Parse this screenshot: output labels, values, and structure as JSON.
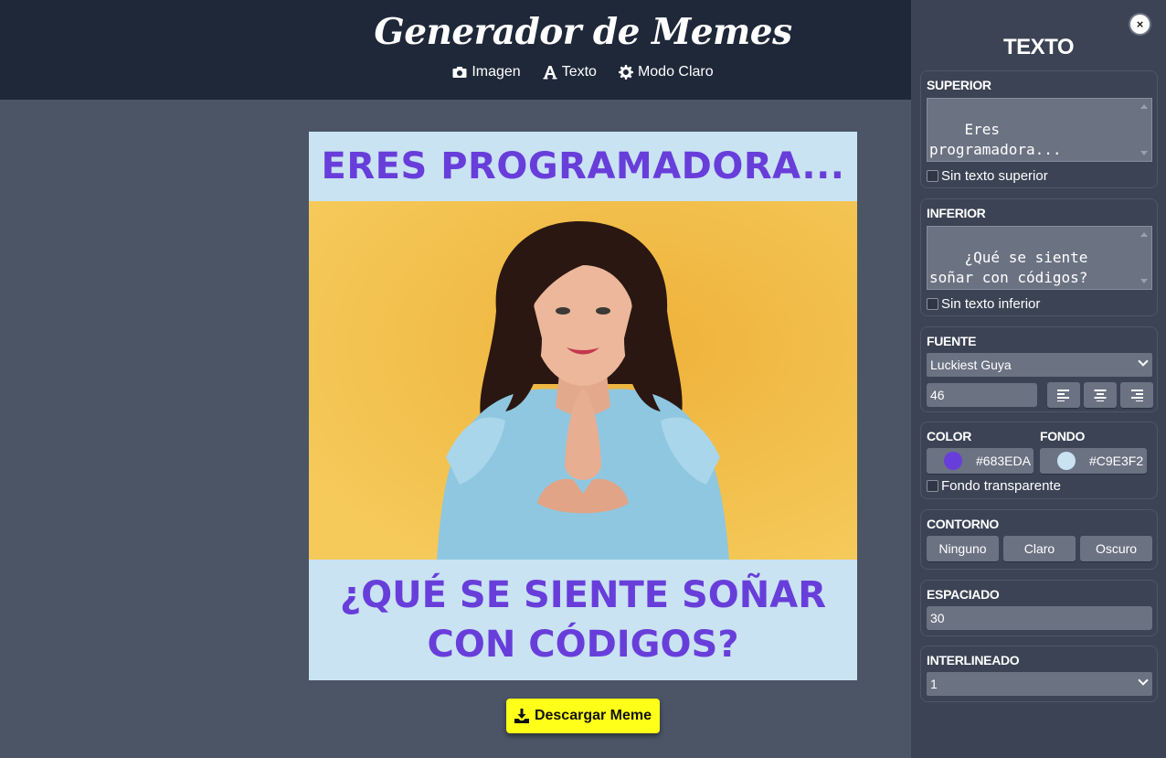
{
  "header": {
    "title": "Generador de Memes",
    "nav": [
      {
        "label": "Imagen",
        "icon": "camera-icon"
      },
      {
        "label": "Texto",
        "icon": "font-icon"
      },
      {
        "label": "Modo Claro",
        "icon": "gear-icon"
      }
    ]
  },
  "meme": {
    "top_text": "ERES PROGRAMADORA...",
    "bottom_text": "¿QUÉ SE SIENTE SOÑAR CON CÓDIGOS?",
    "text_color": "#683EDA",
    "background": "#C9E3F2",
    "image_bg": "#f0b53c"
  },
  "download": {
    "label": "Descargar Meme",
    "icon": "download-icon",
    "color": "#ffff1a"
  },
  "panel": {
    "close": "×",
    "title": "TEXTO",
    "superior": {
      "label": "SUPERIOR",
      "value": "Eres programadora...",
      "checkbox": "Sin texto superior"
    },
    "inferior": {
      "label": "INFERIOR",
      "value": "¿Qué se siente soñar con códigos?",
      "checkbox": "Sin texto inferior"
    },
    "fuente": {
      "label": "FUENTE",
      "selected": "Luckiest Guya",
      "size": "46"
    },
    "color": {
      "label": "COLOR",
      "value": "#683EDA"
    },
    "fondo": {
      "label": "FONDO",
      "value": "#C9E3F2",
      "checkbox": "Fondo transparente"
    },
    "contorno": {
      "label": "CONTORNO",
      "options": [
        "Ninguno",
        "Claro",
        "Oscuro"
      ]
    },
    "espaciado": {
      "label": "ESPACIADO",
      "value": "30"
    },
    "interlineado": {
      "label": "INTERLINEADO",
      "selected": "1"
    }
  }
}
